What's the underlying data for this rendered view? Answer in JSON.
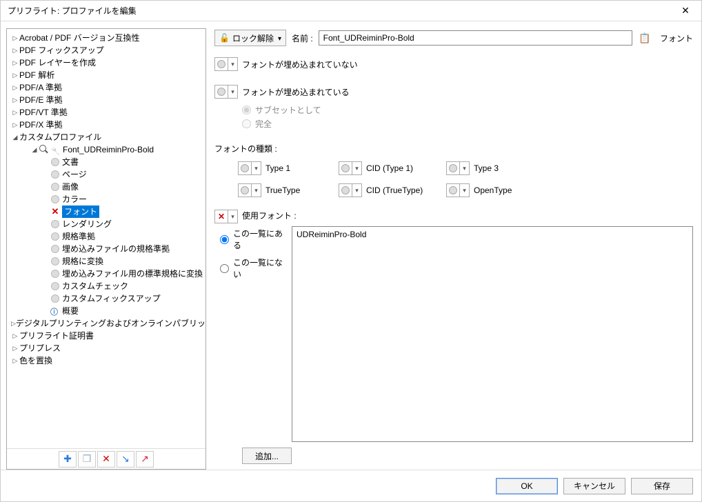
{
  "window": {
    "title": "プリフライト: プロファイルを編集"
  },
  "header": {
    "unlock": "ロック解除",
    "name_label": "名前 :",
    "name_value": "Font_UDReiminPro-Bold",
    "right_label": "フォント"
  },
  "tree": {
    "top": [
      "Acrobat / PDF バージョン互換性",
      "PDF フィックスアップ",
      "PDF レイヤーを作成",
      "PDF 解析",
      "PDF/A 準拠",
      "PDF/E 準拠",
      "PDF/VT 準拠",
      "PDF/X 準拠"
    ],
    "custom_profile": "カスタムプロファイル",
    "profile_name": "Font_UDReiminPro-Bold",
    "children": [
      "文書",
      "ページ",
      "画像",
      "カラー",
      "フォント",
      "レンダリング",
      "規格準拠",
      "埋め込みファイルの規格準拠",
      "規格に変換",
      "埋め込みファイル用の標準規格に変換",
      "カスタムチェック",
      "カスタムフィックスアップ"
    ],
    "summary": "概要",
    "bottom": [
      "デジタルプリンティングおよびオンラインパブリッシング",
      "プリフライト証明書",
      "プリプレス",
      "色を置換"
    ]
  },
  "checks": {
    "not_embedded": "フォントが埋め込まれていない",
    "embedded": "フォントが埋め込まれている",
    "subset": "サブセットとして",
    "full": "完全"
  },
  "font_type": {
    "label": "フォントの種類 :",
    "items": [
      "Type 1",
      "CID (Type 1)",
      "Type 3",
      "TrueType",
      "CID (TrueType)",
      "OpenType"
    ]
  },
  "used_font": {
    "label": "使用フォント :",
    "in_list": "この一覧にある",
    "not_in_list": "この一覧にない",
    "list_items": [
      "UDReiminPro-Bold"
    ],
    "add": "追加..."
  },
  "footer": {
    "ok": "OK",
    "cancel": "キャンセル",
    "save": "保存"
  }
}
